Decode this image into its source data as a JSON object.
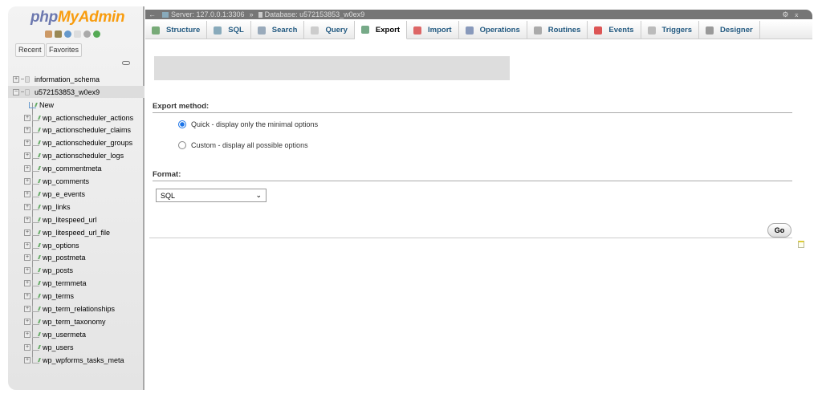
{
  "app": {
    "logo_php": "php",
    "logo_rest": "MyAdmin"
  },
  "sidebar": {
    "recent": "Recent",
    "favorites": "Favorites",
    "databases": [
      {
        "name": "information_schema",
        "expanded": false
      },
      {
        "name": "u572153853_w0ex9",
        "expanded": true
      }
    ],
    "new_label": "New",
    "tables": [
      "wp_actionscheduler_actions",
      "wp_actionscheduler_claims",
      "wp_actionscheduler_groups",
      "wp_actionscheduler_logs",
      "wp_commentmeta",
      "wp_comments",
      "wp_e_events",
      "wp_links",
      "wp_litespeed_url",
      "wp_litespeed_url_file",
      "wp_options",
      "wp_postmeta",
      "wp_posts",
      "wp_termmeta",
      "wp_terms",
      "wp_term_relationships",
      "wp_term_taxonomy",
      "wp_usermeta",
      "wp_users",
      "wp_wpforms_tasks_meta"
    ]
  },
  "breadcrumb": {
    "server": "Server: 127.0.0.1:3306",
    "separator": "»",
    "database": "Database: u572153853_w0ex9"
  },
  "tabs": [
    {
      "label": "Structure",
      "icon": "structure-icon",
      "color": "#7a7"
    },
    {
      "label": "SQL",
      "icon": "sql-icon",
      "color": "#8ab"
    },
    {
      "label": "Search",
      "icon": "search-icon",
      "color": "#9ab"
    },
    {
      "label": "Query",
      "icon": "query-icon",
      "color": "#ccc"
    },
    {
      "label": "Export",
      "icon": "export-icon",
      "color": "#7a8",
      "active": true
    },
    {
      "label": "Import",
      "icon": "import-icon",
      "color": "#d66"
    },
    {
      "label": "Operations",
      "icon": "wrench-icon",
      "color": "#89b"
    },
    {
      "label": "Routines",
      "icon": "routines-icon",
      "color": "#aaa"
    },
    {
      "label": "Events",
      "icon": "clock-icon",
      "color": "#d55"
    },
    {
      "label": "Triggers",
      "icon": "triggers-icon",
      "color": "#bbb"
    },
    {
      "label": "Designer",
      "icon": "designer-icon",
      "color": "#999"
    }
  ],
  "export": {
    "method_label": "Export method:",
    "quick": "Quick - display only the minimal options",
    "custom": "Custom - display all possible options",
    "format_label": "Format:",
    "format_value": "SQL",
    "go": "Go"
  }
}
